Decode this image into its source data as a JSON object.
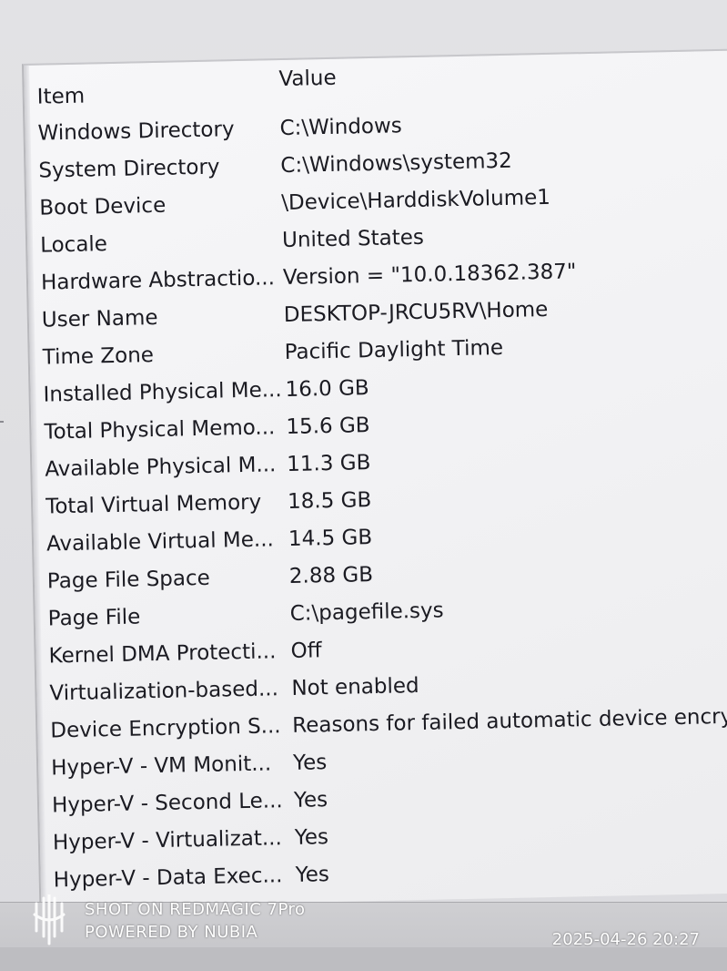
{
  "table": {
    "headers": {
      "item": "Item",
      "value": "Value"
    },
    "rows": [
      {
        "item": "Windows Directory",
        "value": "C:\\Windows"
      },
      {
        "item": "System Directory",
        "value": "C:\\Windows\\system32"
      },
      {
        "item": "Boot Device",
        "value": "\\Device\\HarddiskVolume1"
      },
      {
        "item": "Locale",
        "value": "United States"
      },
      {
        "item": "Hardware Abstractio...",
        "value": "Version = \"10.0.18362.387\""
      },
      {
        "item": "User Name",
        "value": "DESKTOP-JRCU5RV\\Home"
      },
      {
        "item": "Time Zone",
        "value": "Pacific Daylight Time"
      },
      {
        "item": "Installed Physical Me...",
        "value": "16.0 GB"
      },
      {
        "item": "Total Physical Memo...",
        "value": "15.6 GB"
      },
      {
        "item": "Available Physical M...",
        "value": "11.3 GB"
      },
      {
        "item": "Total Virtual Memory",
        "value": "18.5 GB"
      },
      {
        "item": "Available Virtual Me...",
        "value": "14.5 GB"
      },
      {
        "item": "Page File Space",
        "value": "2.88 GB"
      },
      {
        "item": "Page File",
        "value": "C:\\pagefile.sys"
      },
      {
        "item": "Kernel DMA Protecti...",
        "value": "Off"
      },
      {
        "item": "Virtualization-based...",
        "value": "Not enabled"
      },
      {
        "item": "Device Encryption S...",
        "value": "Reasons for failed automatic device encrypt"
      },
      {
        "item": "Hyper-V - VM Monit...",
        "value": "Yes"
      },
      {
        "item": "Hyper-V - Second Le...",
        "value": "Yes"
      },
      {
        "item": "Hyper-V - Virtualizat...",
        "value": "Yes"
      },
      {
        "item": "Hyper-V - Data Exec...",
        "value": "Yes"
      }
    ]
  },
  "watermark": {
    "line1": "SHOT ON REDMAGIC 7Pro",
    "line2": "POWERED BY NUBIA",
    "datetime": "2025-04-26  20:27"
  }
}
